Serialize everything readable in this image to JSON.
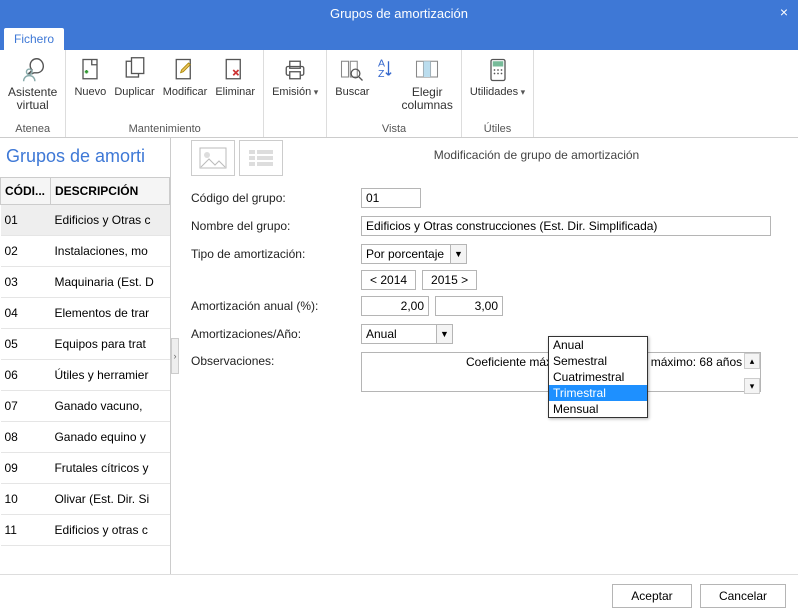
{
  "window": {
    "title": "Grupos de amortización",
    "close": "×"
  },
  "tabs": {
    "active": "Fichero"
  },
  "ribbon": {
    "groups": [
      {
        "label": "Atenea",
        "items": [
          {
            "key": "asistente",
            "label": "Asistente\nvirtual"
          }
        ]
      },
      {
        "label": "Mantenimiento",
        "items": [
          {
            "key": "nuevo",
            "label": "Nuevo"
          },
          {
            "key": "duplicar",
            "label": "Duplicar"
          },
          {
            "key": "modificar",
            "label": "Modificar"
          },
          {
            "key": "eliminar",
            "label": "Eliminar"
          }
        ]
      },
      {
        "label": "",
        "items": [
          {
            "key": "emision",
            "label": "Emisión",
            "dropdown": true
          }
        ]
      },
      {
        "label": "Vista",
        "items": [
          {
            "key": "buscar",
            "label": "Buscar"
          },
          {
            "key": "sort",
            "label": ""
          },
          {
            "key": "elegir",
            "label": "Elegir\ncolumnas"
          }
        ]
      },
      {
        "label": "Útiles",
        "items": [
          {
            "key": "utilidades",
            "label": "Utilidades",
            "dropdown": true
          }
        ]
      }
    ]
  },
  "leftpane": {
    "title": "Grupos de amorti",
    "columns": [
      "CÓDI...",
      "DESCRIPCIÓN"
    ],
    "rows": [
      {
        "cod": "01",
        "desc": "Edificios y Otras c",
        "sel": true
      },
      {
        "cod": "02",
        "desc": "Instalaciones, mo"
      },
      {
        "cod": "03",
        "desc": "Maquinaria (Est. D"
      },
      {
        "cod": "04",
        "desc": "Elementos de trar"
      },
      {
        "cod": "05",
        "desc": "Equipos para trat"
      },
      {
        "cod": "06",
        "desc": "Útiles y herramier"
      },
      {
        "cod": "07",
        "desc": "Ganado vacuno,"
      },
      {
        "cod": "08",
        "desc": "Ganado equino y"
      },
      {
        "cod": "09",
        "desc": "Frutales cítricos y"
      },
      {
        "cod": "10",
        "desc": "Olivar (Est. Dir. Si"
      },
      {
        "cod": "11",
        "desc": "Edificios y otras c"
      }
    ]
  },
  "form": {
    "title": "Modificación de grupo de amortización",
    "labels": {
      "codigo": "Código del grupo:",
      "nombre": "Nombre del grupo:",
      "tipo": "Tipo de amortización:",
      "anual": "Amortización anual (%):",
      "por_ano": "Amortizaciones/Año:",
      "obs": "Observaciones:"
    },
    "codigo": "01",
    "nombre": "Edificios y Otras construcciones (Est. Dir. Simplificada)",
    "tipo_value": "Por porcentaje",
    "year_prev": "< 2014",
    "year_next": "2015 >",
    "pct1": "2,00",
    "pct2": "3,00",
    "por_ano_value": "Anual",
    "obs_value": "Coeficiente máximo: 3% - Periodo máximo: 68 años",
    "dropdown": {
      "options": [
        "Anual",
        "Semestral",
        "Cuatrimestral",
        "Trimestral",
        "Mensual"
      ],
      "highlighted": "Trimestral"
    }
  },
  "footer": {
    "accept": "Aceptar",
    "cancel": "Cancelar"
  },
  "chart_data": null
}
